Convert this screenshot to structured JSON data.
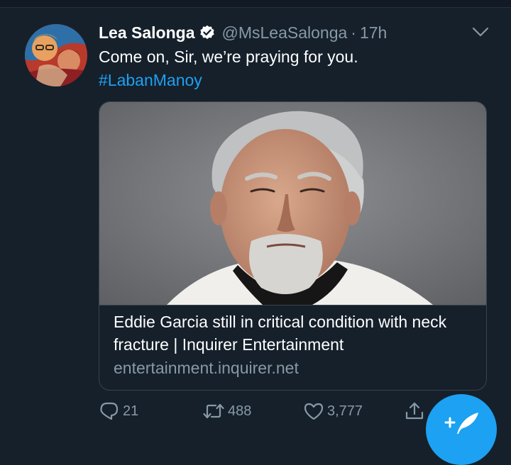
{
  "tweet": {
    "display_name": "Lea Salonga",
    "handle": "@MsLeaSalonga",
    "separator": "·",
    "time": "17h",
    "text": "Come on, Sir, we’re praying for you.",
    "hashtag": "#LabanManoy"
  },
  "card": {
    "title": "Eddie Garcia still in critical condition with neck fracture | Inquirer Entertainment",
    "domain": "entertainment.inquirer.net"
  },
  "actions": {
    "reply_count": "21",
    "retweet_count": "488",
    "like_count": "3,777"
  },
  "icons": {
    "verified": "verified-badge-icon",
    "caret": "chevron-down-icon",
    "reply": "reply-icon",
    "retweet": "retweet-icon",
    "like": "heart-icon",
    "share": "share-icon",
    "compose": "compose-tweet-icon"
  },
  "colors": {
    "background": "#15202b",
    "accent": "#1da1f2",
    "secondary_text": "#8899a6",
    "border": "#38444d"
  }
}
